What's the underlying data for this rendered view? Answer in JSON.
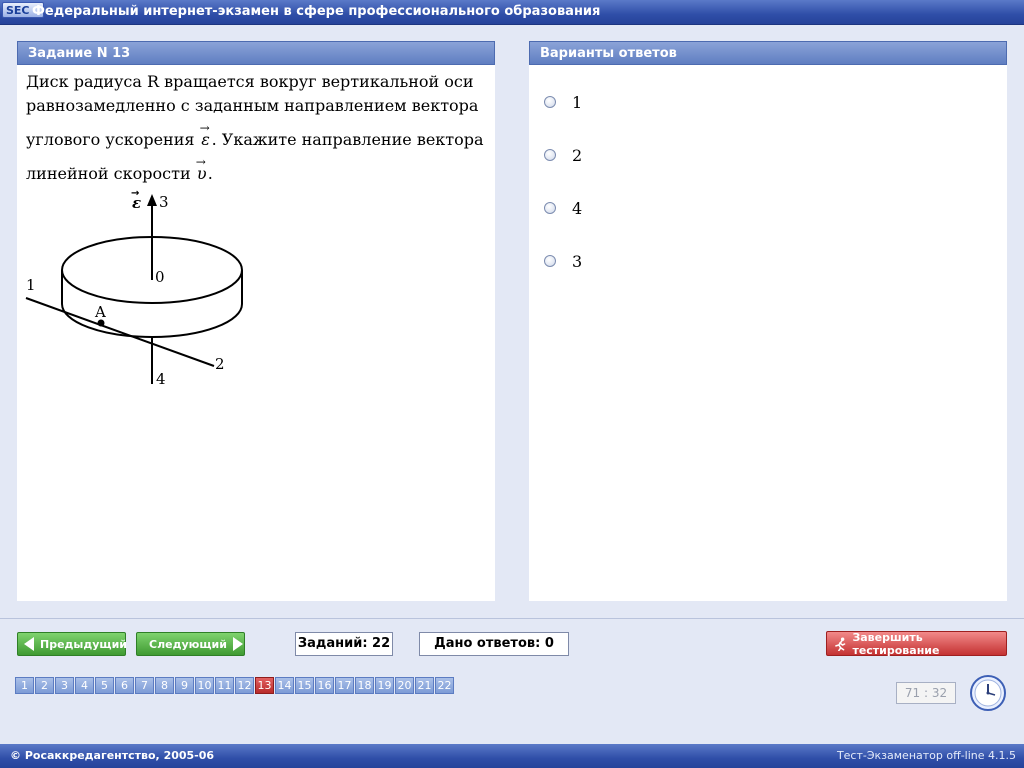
{
  "app": {
    "logo_text": "SEC",
    "title": "Федеральный интернет-экзамен в сфере профессионального образования"
  },
  "task_panel": {
    "header": "Задание N 13",
    "question": {
      "line1": "Диск радиуса R вращается вокруг вертикальной оси",
      "line2": "равнозамедленно с заданным направлением вектора",
      "line3_prefix": "углового ускорения",
      "epsilon_symbol": "ε",
      "line3_suffix": ". Укажите направление вектора",
      "line4_prefix": "линейной скорости",
      "v_symbol": "υ",
      "line4_suffix": "."
    },
    "diagram": {
      "epsilon_label": "ε",
      "label_3": "3",
      "label_0": "0",
      "label_1": "1",
      "label_A": "A",
      "label_2": "2",
      "label_4": "4"
    }
  },
  "answers_panel": {
    "header": "Варианты ответов",
    "options": [
      "1",
      "2",
      "4",
      "3"
    ]
  },
  "nav": {
    "prev_label": "Предыдущий",
    "next_label": "Следующий",
    "tasks_count": "Заданий: 22",
    "answers_given": "Дано ответов: 0",
    "finish_label": "Завершить тестирование"
  },
  "pages": [
    "1",
    "2",
    "3",
    "4",
    "5",
    "6",
    "7",
    "8",
    "9",
    "10",
    "11",
    "12",
    "13",
    "14",
    "15",
    "16",
    "17",
    "18",
    "19",
    "20",
    "21",
    "22"
  ],
  "current_page": "13",
  "timer": "71 : 32",
  "footer": {
    "copyright": "© Росаккредагентство, 2005-06",
    "version": "Тест-Экзаменатор off-line 4.1.5"
  },
  "colors": {
    "title_bar": "#2f4ea8",
    "panel_header": "#6f8cc9",
    "nav_green": "#4da83f",
    "finish_red": "#cf3b3b",
    "current_page": "#c83a3a"
  }
}
